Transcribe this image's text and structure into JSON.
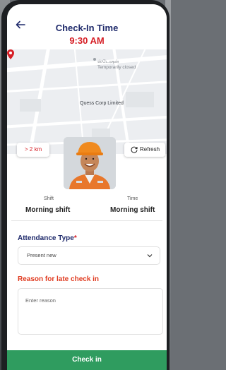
{
  "header": {
    "title": "Check-In Time",
    "time": "9:30 AM"
  },
  "map": {
    "small_label": "ஸ்டேஷன்\nTemporarily closed",
    "small_label_line1": "•",
    "small_label_line2": "ஸ்டேஷன்",
    "small_label_line3": "Temporarily closed",
    "location_label": "Quess Corp Limited"
  },
  "chips": {
    "distance": "> 2 km",
    "refresh": "Refresh"
  },
  "info": {
    "shift_label": "Shift",
    "shift_value": "Morning shift",
    "time_label": "Time",
    "time_value": "Morning shift"
  },
  "attendance": {
    "label": "Attendance Type",
    "required_mark": "*",
    "selected": "Present new"
  },
  "reason": {
    "label": "Reason for late check in",
    "placeholder": "Enter reason"
  },
  "footer": {
    "checkin_label": "Check in"
  },
  "colors": {
    "title": "#1f2a6b",
    "accent_red": "#d61f26",
    "button_green": "#2f9c5f"
  },
  "icons": {
    "back": "arrow-left-icon",
    "pin": "map-pin-icon",
    "refresh": "refresh-icon",
    "chevron": "chevron-down-icon"
  }
}
